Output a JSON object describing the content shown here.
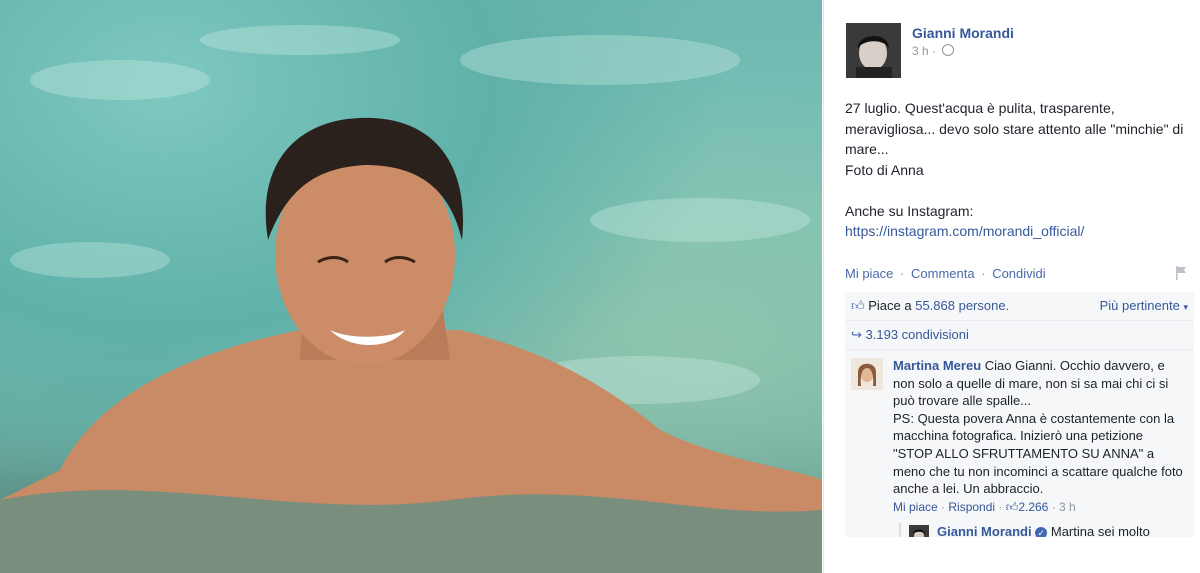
{
  "post": {
    "author": "Gianni Morandi",
    "time": "3 h",
    "time_sep": "·",
    "privacy_icon": "globe-icon",
    "text_lines": [
      "27 luglio. Quest'acqua è pulita, trasparente,",
      "meravigliosa... devo solo stare attento alle \"minchie\" di",
      "mare...",
      "Foto di Anna",
      "",
      "Anche su Instagram:"
    ],
    "link": "https://instagram.com/morandi_official/"
  },
  "actions": {
    "like": "Mi piace",
    "comment": "Commenta",
    "share": "Condividi",
    "sep": "·"
  },
  "stats": {
    "likes_prefix": "Piace a",
    "likes_link": "55.868 persone.",
    "sort": "Più pertinente",
    "shares": "3.193 condivisioni"
  },
  "comment": {
    "author": "Martina Mereu",
    "text": "Ciao Gianni. Occhio davvero, e non solo a quelle di mare, non si sa mai chi ci si può trovare alle spalle...",
    "ps": "PS: Questa povera Anna è costantemente con la macchina fotografica. Inizierò una petizione \"STOP ALLO SFRUTTAMENTO SU ANNA\" a meno che tu non incominci a scattare qualche foto anche a lei. Un abbraccio.",
    "like": "Mi piace",
    "reply": "Rispondi",
    "likes": "2.266",
    "time": "3 h",
    "sep": "·"
  },
  "reply": {
    "author": "Gianni Morandi",
    "text": "Martina sei molto simpatica e spiritosa! Oltre all'abbraccio, ti mando un bacio!"
  },
  "colors": {
    "link": "#365899",
    "muted": "#90949c",
    "stats_bg": "#f6f7f9"
  }
}
